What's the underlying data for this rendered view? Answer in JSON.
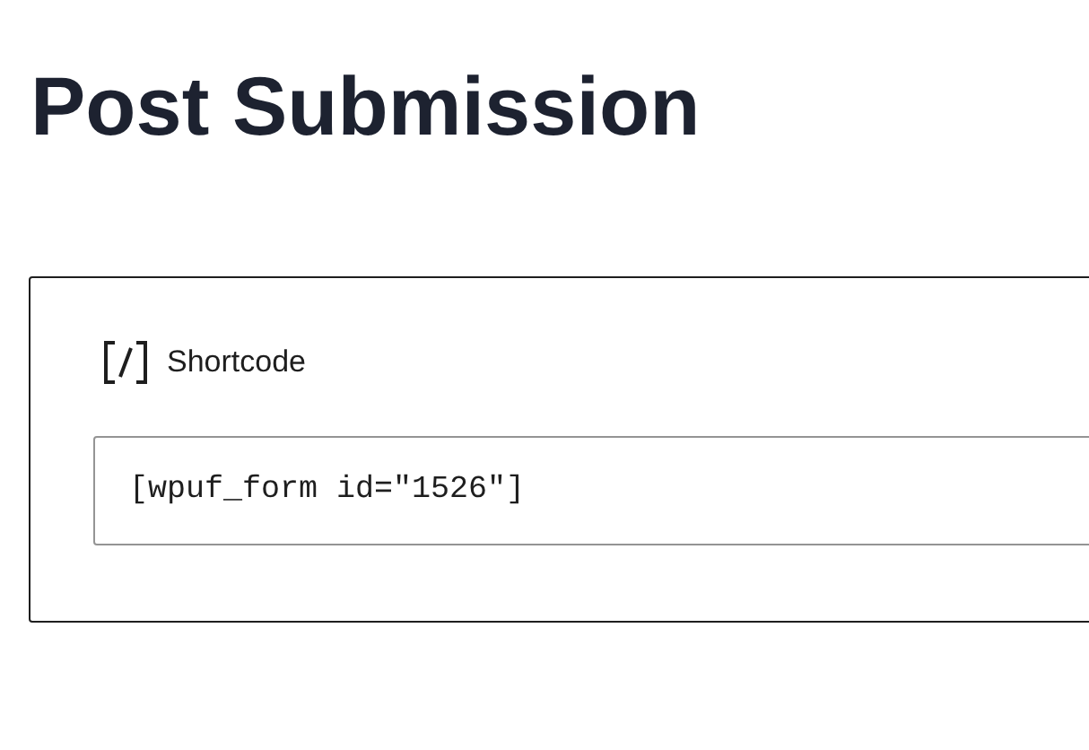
{
  "page": {
    "title": "Post Submission"
  },
  "shortcode_block": {
    "label": "Shortcode",
    "value": "[wpuf_form id=\"1526\"]"
  }
}
